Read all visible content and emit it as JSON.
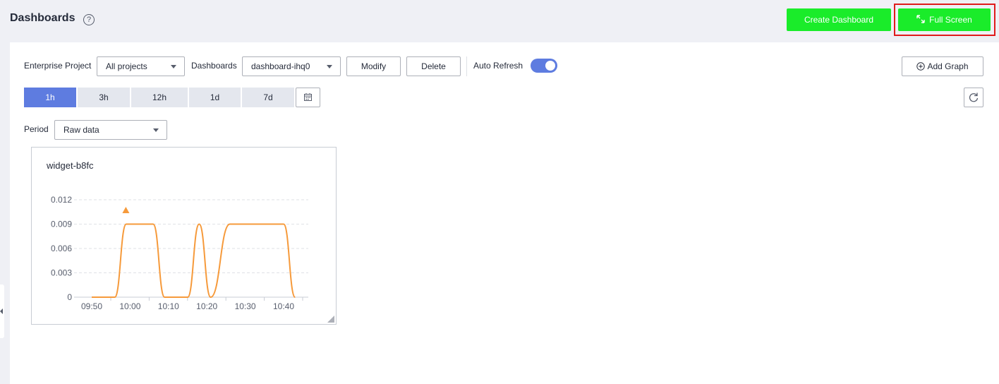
{
  "header": {
    "title": "Dashboards",
    "help_glyph": "?",
    "create_label": "Create Dashboard",
    "fullscreen_label": "Full Screen"
  },
  "toolbar": {
    "enterprise_label": "Enterprise Project",
    "enterprise_value": "All projects",
    "dashboards_label": "Dashboards",
    "dashboards_value": "dashboard-ihq0",
    "modify_label": "Modify",
    "delete_label": "Delete",
    "auto_refresh_label": "Auto Refresh",
    "auto_refresh_on": true,
    "add_graph_label": "Add Graph"
  },
  "time_ranges": {
    "items": [
      "1h",
      "3h",
      "12h",
      "1d",
      "7d"
    ],
    "active": "1h"
  },
  "period": {
    "label": "Period",
    "value": "Raw data"
  },
  "widget": {
    "title": "widget-b8fc"
  },
  "colors": {
    "green": "#1aec2a",
    "accent": "#5e7ce0",
    "highlight": "#e01b1b",
    "series": "#f69a3b"
  },
  "chart_data": {
    "type": "line",
    "x_ticks": [
      "09:50",
      "10:00",
      "10:10",
      "10:20",
      "10:30",
      "10:40"
    ],
    "y_ticks": [
      "0",
      "0.003",
      "0.006",
      "0.009",
      "0.012"
    ],
    "ylim": [
      0,
      0.012
    ],
    "series": [
      {
        "points": [
          [
            "09:50",
            0
          ],
          [
            "09:56",
            0
          ],
          [
            "09:59",
            0.009
          ],
          [
            "10:06",
            0.009
          ],
          [
            "10:09",
            0
          ],
          [
            "10:15",
            0
          ],
          [
            "10:18",
            0.009
          ],
          [
            "10:21",
            0
          ],
          [
            "10:26",
            0.009
          ],
          [
            "10:40",
            0.009
          ],
          [
            "10:43",
            0
          ]
        ]
      }
    ],
    "marker": {
      "x": "10:00",
      "shape": "triangle"
    },
    "grid": true
  }
}
